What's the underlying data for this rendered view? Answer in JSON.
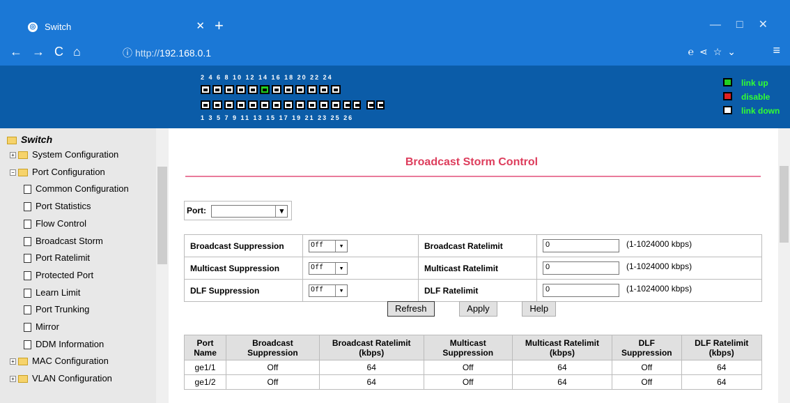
{
  "browser": {
    "tab_title": "Switch",
    "url_prefix": "http://",
    "url_host": "192.168.0.1",
    "favicon": "globe-icon"
  },
  "banner": {
    "top_numbers": "2 4 6 8   10 12 14 16   18 20 22 24",
    "bottom_numbers": "1 3 5 7   9 11 13 15   17 19 21 23   25 26",
    "legend_up": "link up",
    "legend_disable": "disable",
    "legend_down": "link down",
    "colors": {
      "up": "#22d022",
      "disable": "#e02020",
      "down": "#ffffff"
    }
  },
  "sidebar": {
    "root": "Switch",
    "items": [
      {
        "label": "System Configuration",
        "type": "folder"
      },
      {
        "label": "Port Configuration",
        "type": "folder-open"
      },
      {
        "label": "Common Configuration",
        "type": "doc"
      },
      {
        "label": "Port Statistics",
        "type": "doc"
      },
      {
        "label": "Flow Control",
        "type": "doc"
      },
      {
        "label": "Broadcast Storm",
        "type": "doc"
      },
      {
        "label": "Port Ratelimit",
        "type": "doc"
      },
      {
        "label": "Protected Port",
        "type": "doc"
      },
      {
        "label": "Learn Limit",
        "type": "doc"
      },
      {
        "label": "Port Trunking",
        "type": "doc"
      },
      {
        "label": "Mirror",
        "type": "doc"
      },
      {
        "label": "DDM Information",
        "type": "doc"
      },
      {
        "label": "MAC Configuration",
        "type": "folder"
      },
      {
        "label": "VLAN Configuration",
        "type": "folder"
      }
    ]
  },
  "main": {
    "title": "Broadcast Storm Control",
    "port_label": "Port:",
    "rows": [
      {
        "label": "Broadcast Suppression",
        "value": "Off",
        "rate_label": "Broadcast Ratelimit",
        "rate": "0",
        "range": "(1-1024000 kbps)"
      },
      {
        "label": "Multicast Suppression",
        "value": "Off",
        "rate_label": "Multicast Ratelimit",
        "rate": "0",
        "range": "(1-1024000 kbps)"
      },
      {
        "label": "DLF Suppression",
        "value": "Off",
        "rate_label": "DLF Ratelimit",
        "rate": "0",
        "range": "(1-1024000 kbps)"
      }
    ],
    "buttons": {
      "refresh": "Refresh",
      "apply": "Apply",
      "help": "Help"
    },
    "table": {
      "headers": [
        "Port Name",
        "Broadcast Suppression",
        "Broadcast Ratelimit (kbps)",
        "Multicast Suppression",
        "Multicast Ratelimit (kbps)",
        "DLF Suppression",
        "DLF Ratelimit (kbps)"
      ],
      "rows": [
        [
          "ge1/1",
          "Off",
          "64",
          "Off",
          "64",
          "Off",
          "64"
        ],
        [
          "ge1/2",
          "Off",
          "64",
          "Off",
          "64",
          "Off",
          "64"
        ]
      ]
    }
  }
}
